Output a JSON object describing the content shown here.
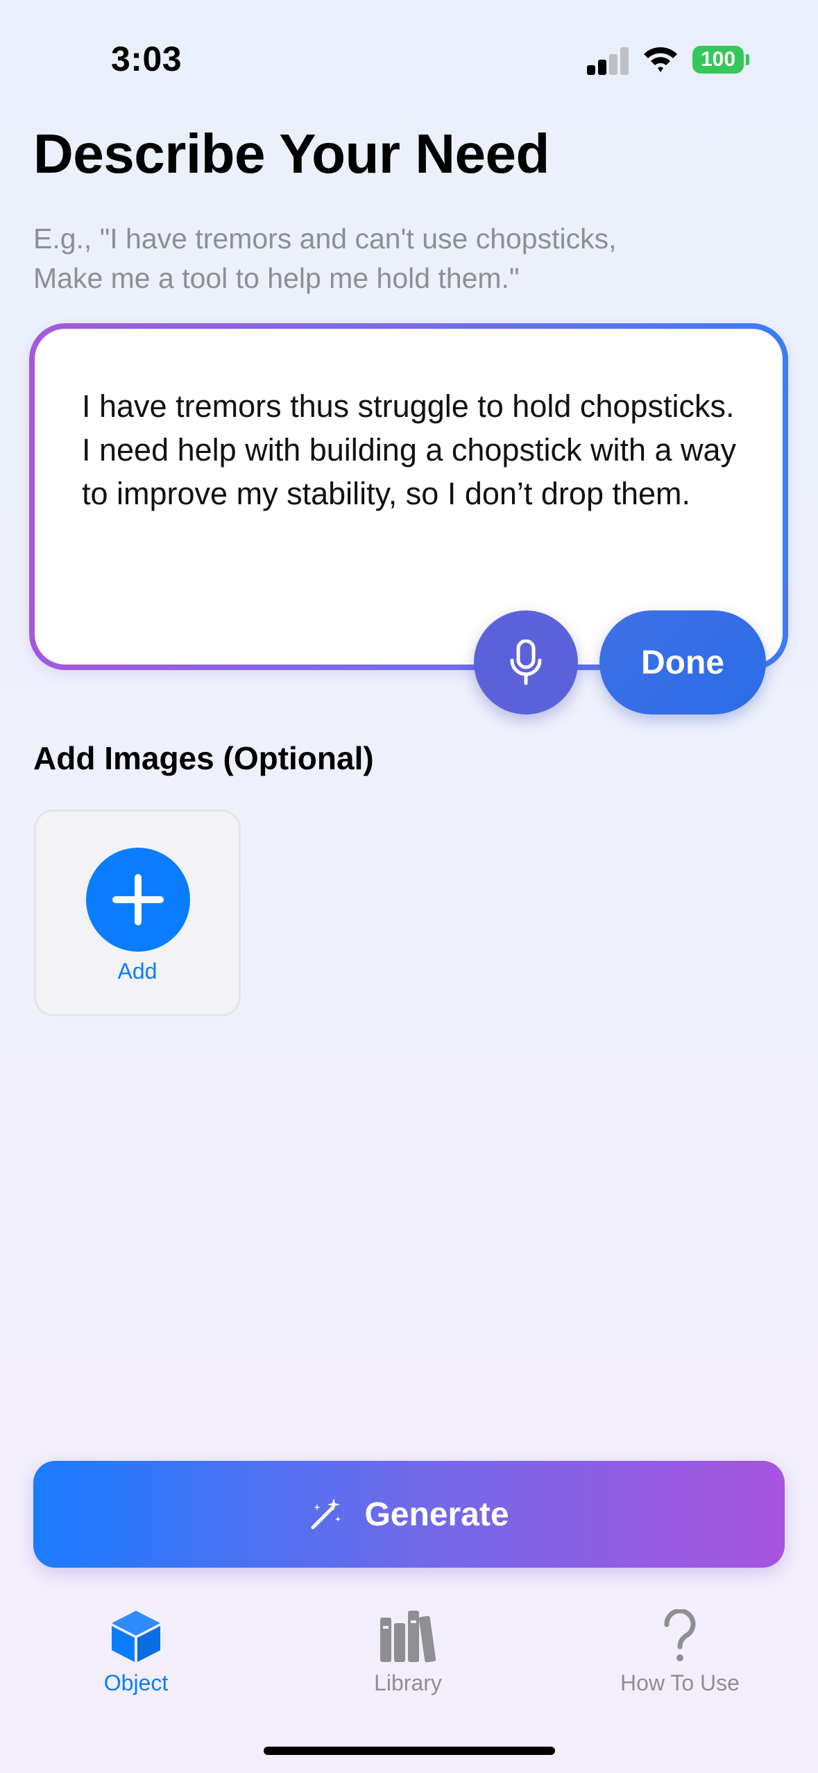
{
  "status_bar": {
    "time": "3:03",
    "battery": "100",
    "icons": [
      "cellular-signal-icon",
      "wifi-icon",
      "battery-icon"
    ]
  },
  "page": {
    "title": "Describe Your Need",
    "hint_line1": "E.g., \"I have tremors and can't use chopsticks,",
    "hint_line2": "Make me a tool to help me hold them.\""
  },
  "need_input": {
    "value": "I have tremors thus struggle to hold chopsticks. I need help with building a chopstick with a way to improve my stability, so I don’t drop them."
  },
  "buttons": {
    "done": "Done",
    "mic_icon": "microphone-icon",
    "generate": "Generate",
    "generate_icon": "magic-wand-sparkles-icon"
  },
  "images": {
    "section_label": "Add Images (Optional)",
    "add_label": "Add",
    "add_icon": "plus-icon"
  },
  "tab_bar": {
    "tabs": [
      {
        "label": "Object",
        "icon": "cube-icon",
        "active": true
      },
      {
        "label": "Library",
        "icon": "books-icon",
        "active": false
      },
      {
        "label": "How To Use",
        "icon": "question-mark-icon",
        "active": false
      }
    ]
  },
  "colors": {
    "accent_blue": "#0a7dff",
    "gradient_start": "#1a7cff",
    "gradient_end": "#a854df",
    "mic_button": "#5b62d9",
    "done_button": "#2a6ee8",
    "battery_green": "#34c759",
    "inactive_gray": "#8e8e93"
  }
}
